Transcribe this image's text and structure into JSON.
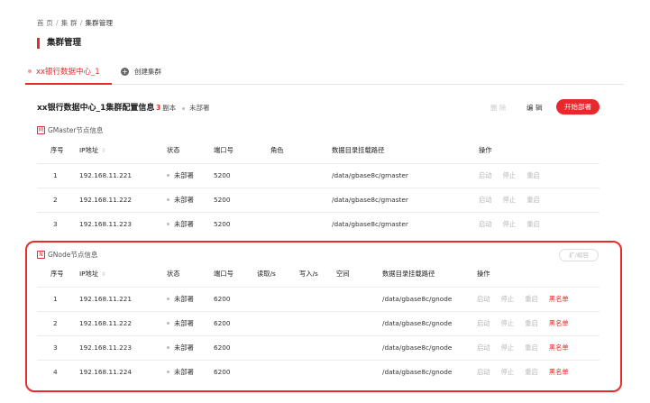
{
  "breadcrumb": {
    "home": "首 页",
    "cluster": "集 群",
    "current": "集群管理",
    "sep": "/"
  },
  "page_title": "集群管理",
  "tabs": {
    "active": "xx银行数据中心_1",
    "add": "创建集群",
    "add_icon": "plus-icon"
  },
  "config": {
    "title": "xx银行数据中心_1集群配置信息",
    "replicas_num": "3",
    "replicas_unit": "副本",
    "state": "未部署",
    "delete": "删 除",
    "edit": "编 辑",
    "deploy": "开始部署"
  },
  "gmaster": {
    "icon_letter": "M",
    "title": "GMaster节点信息",
    "headers": [
      "序号",
      "IP地址",
      "状态",
      "端口号",
      "角色",
      "数据目录挂载路径",
      "操作"
    ],
    "sort_icon": "⇳",
    "rows": [
      {
        "idx": "1",
        "ip": "192.168.11.221",
        "status": "未部署",
        "port": "5200",
        "role": "",
        "path": "/data/gbase8c/gmaster"
      },
      {
        "idx": "2",
        "ip": "192.168.11.222",
        "status": "未部署",
        "port": "5200",
        "role": "",
        "path": "/data/gbase8c/gmaster"
      },
      {
        "idx": "3",
        "ip": "192.168.11.223",
        "status": "未部署",
        "port": "5200",
        "role": "",
        "path": "/data/gbase8c/gmaster"
      }
    ],
    "actions": [
      "启动",
      "停止",
      "重启"
    ]
  },
  "gnode": {
    "icon_letter": "N",
    "title": "GNode节点信息",
    "expand": "扩/缩容",
    "headers": [
      "序号",
      "IP地址",
      "状态",
      "端口号",
      "读取/s",
      "写入/s",
      "空间",
      "数据目录挂载路径",
      "操作"
    ],
    "rows": [
      {
        "idx": "1",
        "ip": "192.168.11.221",
        "status": "未部署",
        "port": "6200",
        "read": "",
        "write": "",
        "space": "",
        "path": "/data/gbase8c/gnode"
      },
      {
        "idx": "2",
        "ip": "192.168.11.222",
        "status": "未部署",
        "port": "6200",
        "read": "",
        "write": "",
        "space": "",
        "path": "/data/gbase8c/gnode"
      },
      {
        "idx": "3",
        "ip": "192.168.11.223",
        "status": "未部署",
        "port": "6200",
        "read": "",
        "write": "",
        "space": "",
        "path": "/data/gbase8c/gnode"
      },
      {
        "idx": "4",
        "ip": "192.168.11.224",
        "status": "未部署",
        "port": "6200",
        "read": "",
        "write": "",
        "space": "",
        "path": "/data/gbase8c/gnode"
      }
    ],
    "actions": [
      "启动",
      "停止",
      "重启",
      "黑名单"
    ]
  },
  "colors": {
    "accent": "#e8282b",
    "muted": "#b8b8b8",
    "highlight": "#e82b2b"
  }
}
